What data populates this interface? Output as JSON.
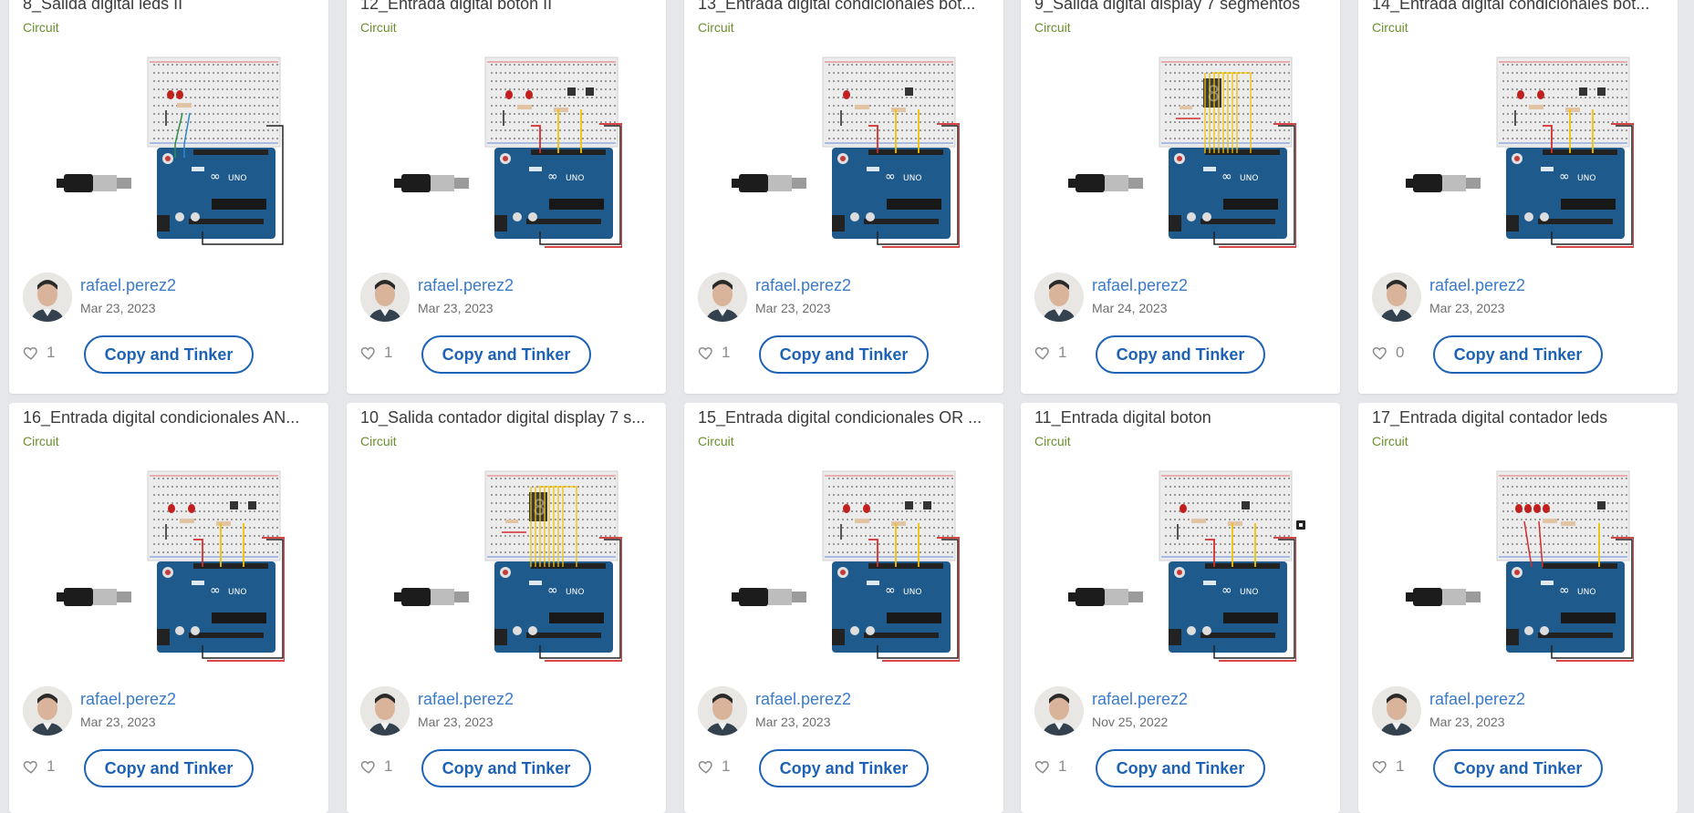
{
  "cards": [
    {
      "title": "8_Salida digital leds II",
      "type": "Circuit",
      "author": "rafael.perez2",
      "date": "Mar 23, 2023",
      "likes": "1",
      "button": "Copy and Tinker",
      "variant": "leds2"
    },
    {
      "title": "12_Entrada digital boton II",
      "type": "Circuit",
      "author": "rafael.perez2",
      "date": "Mar 23, 2023",
      "likes": "1",
      "button": "Copy and Tinker",
      "variant": "buttons"
    },
    {
      "title": "13_Entrada digital condicionales bot...",
      "type": "Circuit",
      "author": "rafael.perez2",
      "date": "Mar 23, 2023",
      "likes": "1",
      "button": "Copy and Tinker",
      "variant": "button1"
    },
    {
      "title": "9_Salida digital display 7 segmentos",
      "type": "Circuit",
      "author": "rafael.perez2",
      "date": "Mar 24, 2023",
      "likes": "1",
      "button": "Copy and Tinker",
      "variant": "display"
    },
    {
      "title": "14_Entrada digital condicionales bot...",
      "type": "Circuit",
      "author": "rafael.perez2",
      "date": "Mar 23, 2023",
      "likes": "0",
      "button": "Copy and Tinker",
      "variant": "buttons"
    },
    {
      "title": "16_Entrada digital condicionales AN...",
      "type": "Circuit",
      "author": "rafael.perez2",
      "date": "Mar 23, 2023",
      "likes": "1",
      "button": "Copy and Tinker",
      "variant": "buttons"
    },
    {
      "title": "10_Salida contador digital display 7 s...",
      "type": "Circuit",
      "author": "rafael.perez2",
      "date": "Mar 23, 2023",
      "likes": "1",
      "button": "Copy and Tinker",
      "variant": "display"
    },
    {
      "title": "15_Entrada digital condicionales OR ...",
      "type": "Circuit",
      "author": "rafael.perez2",
      "date": "Mar 23, 2023",
      "likes": "1",
      "button": "Copy and Tinker",
      "variant": "buttons"
    },
    {
      "title": "11_Entrada digital boton",
      "type": "Circuit",
      "author": "rafael.perez2",
      "date": "Nov 25, 2022",
      "likes": "1",
      "button": "Copy and Tinker",
      "variant": "button1"
    },
    {
      "title": "17_Entrada digital contador leds",
      "type": "Circuit",
      "author": "rafael.perez2",
      "date": "Mar 23, 2023",
      "likes": "1",
      "button": "Copy and Tinker",
      "variant": "leds4"
    }
  ],
  "colors": {
    "accent": "#1d62b5",
    "author_link": "#3a7ac9",
    "type_label": "#6a8f2c",
    "arduino_blue": "#1f5a8c",
    "breadboard": "#ececec",
    "led_red": "#c21f1f",
    "wire_yellow": "#f2c200",
    "wire_red": "#d42d2d"
  },
  "icons": {
    "like": "heart-outline-icon",
    "avatar": "user-avatar",
    "stray": "small-dark-square-icon"
  }
}
